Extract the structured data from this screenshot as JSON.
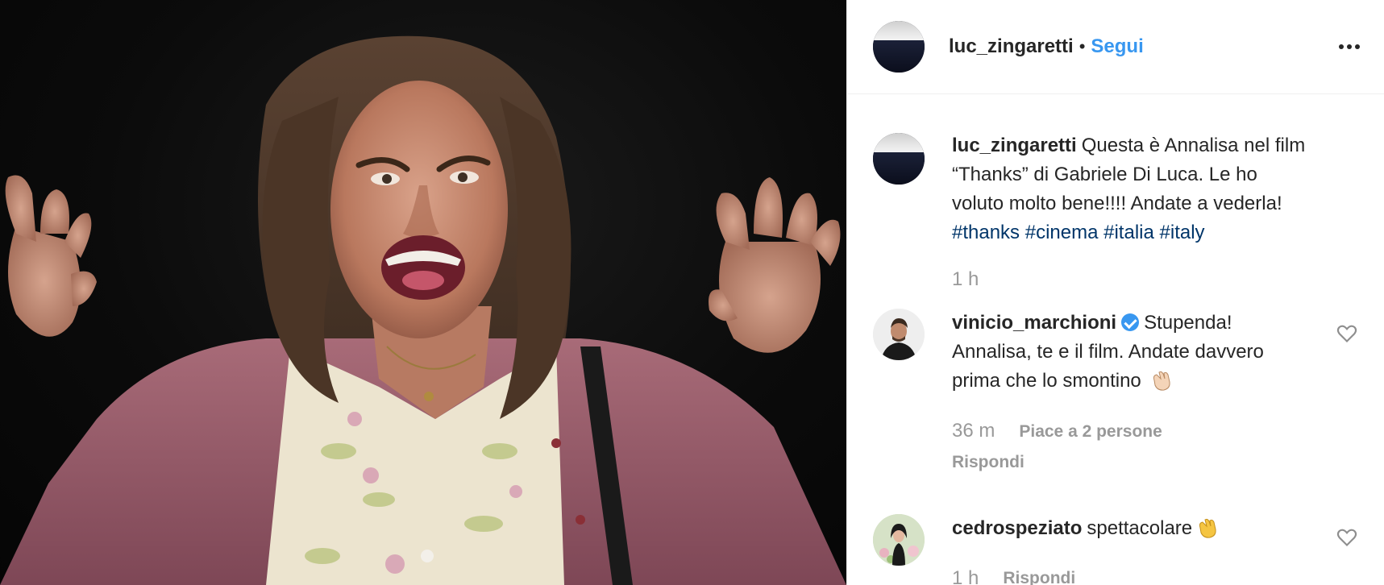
{
  "post": {
    "author": "luc_zingaretti",
    "separator": "•",
    "follow_label": "Segui",
    "more_icon": "more-options-icon"
  },
  "caption": {
    "username": "luc_zingaretti",
    "text": "Questa è Annalisa nel film “Thanks” di Gabriele Di Luca. Le ho voluto molto bene!!!! Andate a vederla!",
    "hashtags": [
      "#thanks",
      "#cinema",
      "#italia",
      "#italy"
    ],
    "time": "1 h"
  },
  "comments": [
    {
      "username": "vinicio_marchioni",
      "verified": true,
      "text": "Stupenda! Annalisa, te e il film. Andate davvero prima che lo smontino",
      "emoji": "clapping-hands-icon",
      "time": "36 m",
      "likes": "Piace a 2 persone",
      "reply": "Rispondi"
    },
    {
      "username": "cedrospeziato",
      "text": "spettacolare",
      "emoji": "clapping-hands-icon",
      "time": "1 h",
      "reply": "Rispondi"
    }
  ],
  "colors": {
    "accent": "#3897f0",
    "hashtag": "#003569",
    "muted": "#999999",
    "text": "#262626"
  }
}
